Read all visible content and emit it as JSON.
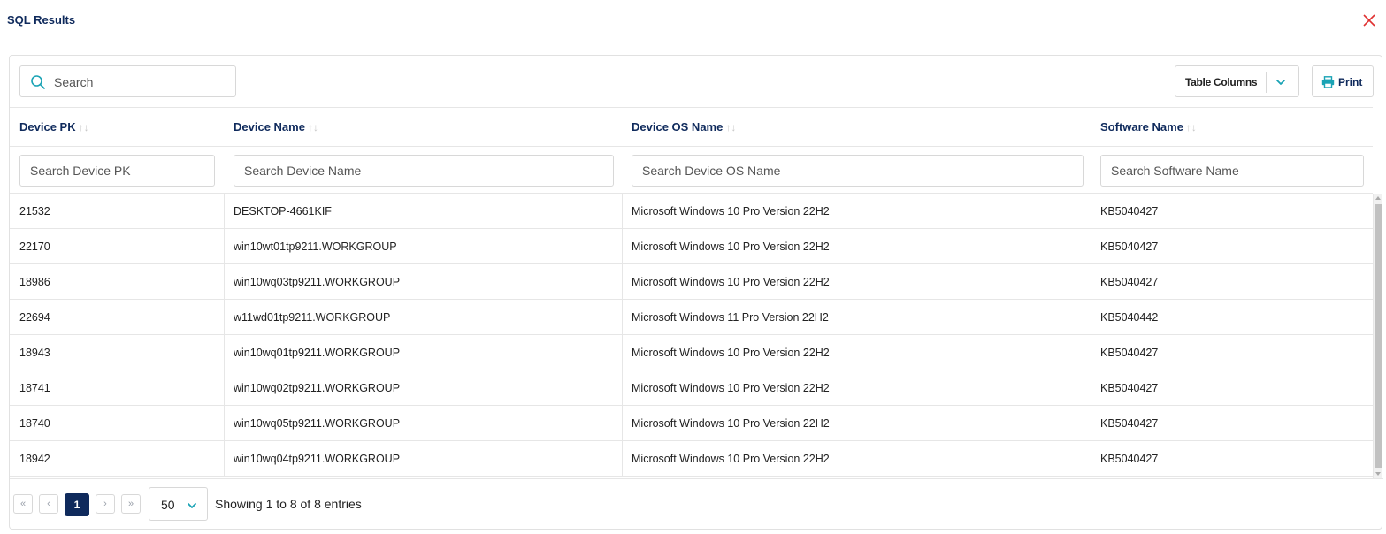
{
  "modal": {
    "title": "SQL Results"
  },
  "toolbar": {
    "search_placeholder": "Search",
    "table_columns_label": "Table Columns",
    "print_label": "Print"
  },
  "table": {
    "columns": [
      {
        "label": "Device PK",
        "filter_placeholder": "Search Device PK"
      },
      {
        "label": "Device Name",
        "filter_placeholder": "Search Device Name"
      },
      {
        "label": "Device OS Name",
        "filter_placeholder": "Search Device OS Name"
      },
      {
        "label": "Software Name",
        "filter_placeholder": "Search Software Name"
      }
    ],
    "rows": [
      [
        "21532",
        "DESKTOP-4661KIF",
        "Microsoft Windows 10 Pro Version 22H2",
        "KB5040427"
      ],
      [
        "22170",
        "win10wt01tp9211.WORKGROUP",
        "Microsoft Windows 10 Pro Version 22H2",
        "KB5040427"
      ],
      [
        "18986",
        "win10wq03tp9211.WORKGROUP",
        "Microsoft Windows 10 Pro Version 22H2",
        "KB5040427"
      ],
      [
        "22694",
        "w11wd01tp9211.WORKGROUP",
        "Microsoft Windows 11 Pro Version 22H2",
        "KB5040442"
      ],
      [
        "18943",
        "win10wq01tp9211.WORKGROUP",
        "Microsoft Windows 10 Pro Version 22H2",
        "KB5040427"
      ],
      [
        "18741",
        "win10wq02tp9211.WORKGROUP",
        "Microsoft Windows 10 Pro Version 22H2",
        "KB5040427"
      ],
      [
        "18740",
        "win10wq05tp9211.WORKGROUP",
        "Microsoft Windows 10 Pro Version 22H2",
        "KB5040427"
      ],
      [
        "18942",
        "win10wq04tp9211.WORKGROUP",
        "Microsoft Windows 10 Pro Version 22H2",
        "KB5040427"
      ]
    ]
  },
  "pagination": {
    "first_glyph": "«",
    "prev_glyph": "‹",
    "current_page": "1",
    "next_glyph": "›",
    "last_glyph": "»",
    "page_size": "50",
    "entries_text": "Showing 1 to 8 of 8 entries"
  },
  "colors": {
    "brand_navy": "#0f2a5c",
    "accent_teal": "#1aa3b5",
    "close_red": "#e03131"
  },
  "icons": {
    "search": "search-icon",
    "chevron": "chevron-down-icon",
    "print": "printer-icon",
    "close": "close-icon",
    "sort": "sort-icon"
  }
}
